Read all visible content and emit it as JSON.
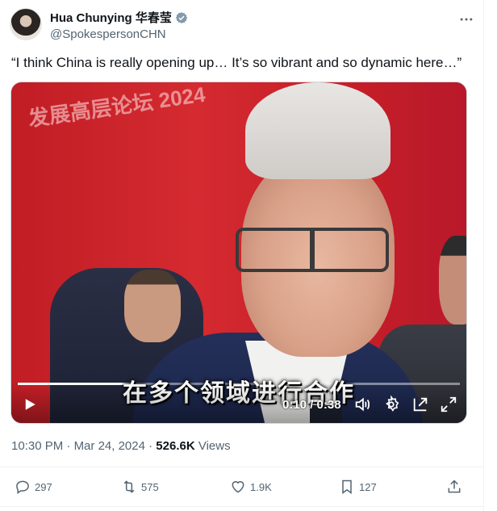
{
  "author": {
    "display_name": "Hua Chunying 华春莹",
    "handle": "@SpokespersonCHN",
    "verified_color": "#829aab"
  },
  "tweet": {
    "text": "“I think China is really opening up… It’s so vibrant and so dynamic here…”"
  },
  "video": {
    "caption": "在多个领域进行合作",
    "time": "0:10 / 0:38",
    "progress": 0.26,
    "background_text": "发展高层论坛 2024"
  },
  "meta": {
    "time": "10:30 PM",
    "separator": "·",
    "date": "Mar 24, 2024",
    "views_count": "526.6K",
    "views_label": "Views"
  },
  "actions": {
    "replies": "297",
    "reposts": "575",
    "likes": "1.9K",
    "bookmarks": "127"
  },
  "icons": [
    "more-icon",
    "verified-badge-icon",
    "play-icon",
    "volume-icon",
    "settings-icon",
    "pip-icon",
    "fullscreen-icon",
    "reply-icon",
    "repost-icon",
    "like-icon",
    "bookmark-icon",
    "share-icon"
  ]
}
